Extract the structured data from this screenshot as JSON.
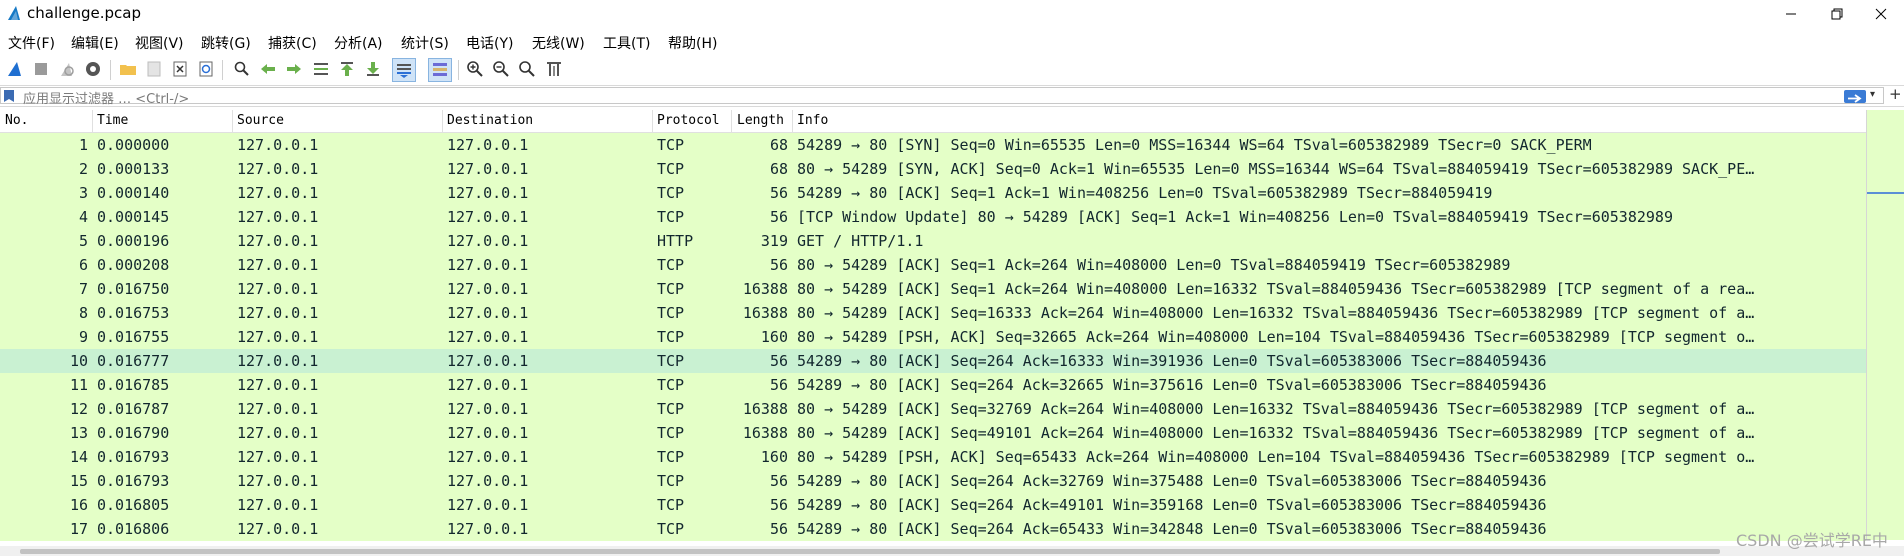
{
  "window": {
    "title": "challenge.pcap",
    "controls": [
      "minimize",
      "maximize",
      "close"
    ]
  },
  "menu": [
    "文件(F)",
    "编辑(E)",
    "视图(V)",
    "跳转(G)",
    "捕获(C)",
    "分析(A)",
    "统计(S)",
    "电话(Y)",
    "无线(W)",
    "工具(T)",
    "帮助(H)"
  ],
  "toolbar": {
    "icons": [
      "shark-fin-start-icon",
      "stop-capture-icon",
      "restart-capture-icon",
      "capture-options-icon",
      "open-file-icon",
      "save-file-icon",
      "close-file-icon",
      "reload-file-icon",
      "find-packet-icon",
      "go-back-icon",
      "go-forward-icon",
      "go-to-packet-icon",
      "go-first-icon",
      "go-last-icon",
      "auto-scroll-icon",
      "colorize-icon",
      "zoom-in-icon",
      "zoom-out-icon",
      "zoom-normal-icon",
      "resize-columns-icon"
    ]
  },
  "filter": {
    "placeholder": "应用显示过滤器 … <Ctrl-/>"
  },
  "columns": [
    "No.",
    "Time",
    "Source",
    "Destination",
    "Protocol",
    "Length",
    "Info"
  ],
  "packets": [
    {
      "no": "1",
      "time": "0.000000",
      "src": "127.0.0.1",
      "dst": "127.0.0.1",
      "proto": "TCP",
      "len": "68",
      "info": "54289 → 80 [SYN] Seq=0 Win=65535 Len=0 MSS=16344 WS=64 TSval=605382989 TSecr=0 SACK_PERM"
    },
    {
      "no": "2",
      "time": "0.000133",
      "src": "127.0.0.1",
      "dst": "127.0.0.1",
      "proto": "TCP",
      "len": "68",
      "info": "80 → 54289 [SYN, ACK] Seq=0 Ack=1 Win=65535 Len=0 MSS=16344 WS=64 TSval=884059419 TSecr=605382989 SACK_PE…"
    },
    {
      "no": "3",
      "time": "0.000140",
      "src": "127.0.0.1",
      "dst": "127.0.0.1",
      "proto": "TCP",
      "len": "56",
      "info": "54289 → 80 [ACK] Seq=1 Ack=1 Win=408256 Len=0 TSval=605382989 TSecr=884059419"
    },
    {
      "no": "4",
      "time": "0.000145",
      "src": "127.0.0.1",
      "dst": "127.0.0.1",
      "proto": "TCP",
      "len": "56",
      "info": "[TCP Window Update] 80 → 54289 [ACK] Seq=1 Ack=1 Win=408256 Len=0 TSval=884059419 TSecr=605382989"
    },
    {
      "no": "5",
      "time": "0.000196",
      "src": "127.0.0.1",
      "dst": "127.0.0.1",
      "proto": "HTTP",
      "len": "319",
      "info": "GET / HTTP/1.1"
    },
    {
      "no": "6",
      "time": "0.000208",
      "src": "127.0.0.1",
      "dst": "127.0.0.1",
      "proto": "TCP",
      "len": "56",
      "info": "80 → 54289 [ACK] Seq=1 Ack=264 Win=408000 Len=0 TSval=884059419 TSecr=605382989"
    },
    {
      "no": "7",
      "time": "0.016750",
      "src": "127.0.0.1",
      "dst": "127.0.0.1",
      "proto": "TCP",
      "len": "16388",
      "info": "80 → 54289 [ACK] Seq=1 Ack=264 Win=408000 Len=16332 TSval=884059436 TSecr=605382989 [TCP segment of a rea…"
    },
    {
      "no": "8",
      "time": "0.016753",
      "src": "127.0.0.1",
      "dst": "127.0.0.1",
      "proto": "TCP",
      "len": "16388",
      "info": "80 → 54289 [ACK] Seq=16333 Ack=264 Win=408000 Len=16332 TSval=884059436 TSecr=605382989 [TCP segment of a…"
    },
    {
      "no": "9",
      "time": "0.016755",
      "src": "127.0.0.1",
      "dst": "127.0.0.1",
      "proto": "TCP",
      "len": "160",
      "info": "80 → 54289 [PSH, ACK] Seq=32665 Ack=264 Win=408000 Len=104 TSval=884059436 TSecr=605382989 [TCP segment o…"
    },
    {
      "no": "10",
      "time": "0.016777",
      "src": "127.0.0.1",
      "dst": "127.0.0.1",
      "proto": "TCP",
      "len": "56",
      "info": "54289 → 80 [ACK] Seq=264 Ack=16333 Win=391936 Len=0 TSval=605383006 TSecr=884059436",
      "selected": true
    },
    {
      "no": "11",
      "time": "0.016785",
      "src": "127.0.0.1",
      "dst": "127.0.0.1",
      "proto": "TCP",
      "len": "56",
      "info": "54289 → 80 [ACK] Seq=264 Ack=32665 Win=375616 Len=0 TSval=605383006 TSecr=884059436"
    },
    {
      "no": "12",
      "time": "0.016787",
      "src": "127.0.0.1",
      "dst": "127.0.0.1",
      "proto": "TCP",
      "len": "16388",
      "info": "80 → 54289 [ACK] Seq=32769 Ack=264 Win=408000 Len=16332 TSval=884059436 TSecr=605382989 [TCP segment of a…"
    },
    {
      "no": "13",
      "time": "0.016790",
      "src": "127.0.0.1",
      "dst": "127.0.0.1",
      "proto": "TCP",
      "len": "16388",
      "info": "80 → 54289 [ACK] Seq=49101 Ack=264 Win=408000 Len=16332 TSval=884059436 TSecr=605382989 [TCP segment of a…"
    },
    {
      "no": "14",
      "time": "0.016793",
      "src": "127.0.0.1",
      "dst": "127.0.0.1",
      "proto": "TCP",
      "len": "160",
      "info": "80 → 54289 [PSH, ACK] Seq=65433 Ack=264 Win=408000 Len=104 TSval=884059436 TSecr=605382989 [TCP segment o…"
    },
    {
      "no": "15",
      "time": "0.016793",
      "src": "127.0.0.1",
      "dst": "127.0.0.1",
      "proto": "TCP",
      "len": "56",
      "info": "54289 → 80 [ACK] Seq=264 Ack=32769 Win=375488 Len=0 TSval=605383006 TSecr=884059436"
    },
    {
      "no": "16",
      "time": "0.016805",
      "src": "127.0.0.1",
      "dst": "127.0.0.1",
      "proto": "TCP",
      "len": "56",
      "info": "54289 → 80 [ACK] Seq=264 Ack=49101 Win=359168 Len=0 TSval=605383006 TSecr=884059436"
    },
    {
      "no": "17",
      "time": "0.016806",
      "src": "127.0.0.1",
      "dst": "127.0.0.1",
      "proto": "TCP",
      "len": "56",
      "info": "54289 → 80 [ACK] Seq=264 Ack=65433 Win=342848 Len=0 TSval=605383006 TSecr=884059436"
    }
  ],
  "watermark": "CSDN @尝试学RE中",
  "colors": {
    "row_bg": "#e4ffc7",
    "row_selected_bg": "#c9f1d2",
    "row_text": "#12272e",
    "accent": "#3a7bd5"
  }
}
